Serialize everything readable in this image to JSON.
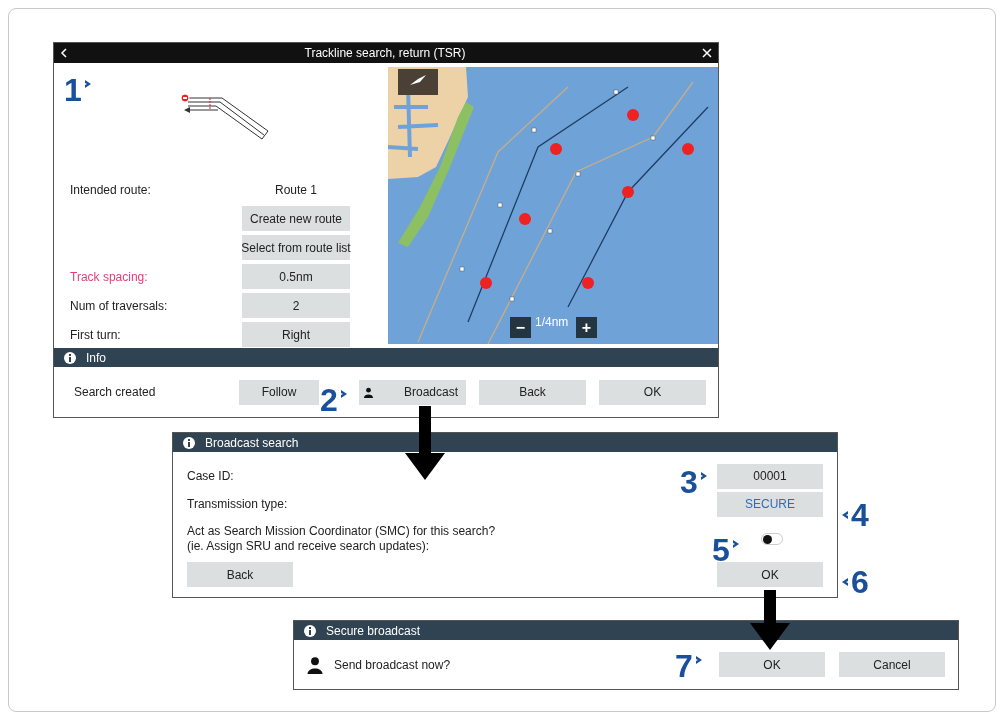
{
  "trackline_window": {
    "title": "Trackline search, return (TSR)",
    "fields": [
      {
        "kind": "text",
        "label": "Intended route:",
        "value": "Route 1",
        "highlighted": false
      },
      {
        "kind": "button",
        "value": "Create new route"
      },
      {
        "kind": "button",
        "value": "Select from route list"
      },
      {
        "kind": "button",
        "label": "Track spacing:",
        "value": "0.5nm",
        "highlighted": true
      },
      {
        "kind": "button",
        "label": "Num of traversals:",
        "value": "2",
        "highlighted": false
      },
      {
        "kind": "button",
        "label": "First turn:",
        "value": "Right",
        "highlighted": false
      }
    ],
    "map": {
      "scale": "1/4nm",
      "zoom_out": "−",
      "zoom_in": "+"
    },
    "info_bar": {
      "title": "Info",
      "message": "Search created",
      "buttons": [
        {
          "label": "Follow",
          "kind": "plain"
        },
        {
          "label": "Broadcast",
          "kind": "person"
        },
        {
          "label": "Back",
          "kind": "plain"
        },
        {
          "label": "OK",
          "kind": "plain"
        }
      ]
    }
  },
  "broadcast_dialog": {
    "title": "Broadcast search",
    "rows": [
      {
        "label": "Case ID:",
        "value": "00001",
        "highlighted": false
      },
      {
        "label": "Transmission type:",
        "value": "SECURE",
        "highlighted": true
      }
    ],
    "smc": {
      "lines": [
        "Act as Search Mission Coordinator (SMC) for this search?",
        "(ie. Assign SRU and receive search updates):"
      ],
      "on": false
    },
    "buttons": [
      {
        "label": "Back"
      },
      {
        "label": "OK"
      }
    ]
  },
  "secure_dialog": {
    "title": "Secure broadcast",
    "message": "Send broadcast now?",
    "buttons": [
      {
        "label": "OK"
      },
      {
        "label": "Cancel"
      }
    ]
  },
  "callouts": [
    {
      "number": "1",
      "kind": "after"
    },
    {
      "number": "2",
      "kind": "after"
    },
    {
      "number": "3",
      "kind": "after"
    },
    {
      "number": "4",
      "kind": "before"
    },
    {
      "number": "5",
      "kind": "after"
    },
    {
      "number": "6",
      "kind": "before"
    },
    {
      "number": "7",
      "kind": "after"
    }
  ]
}
